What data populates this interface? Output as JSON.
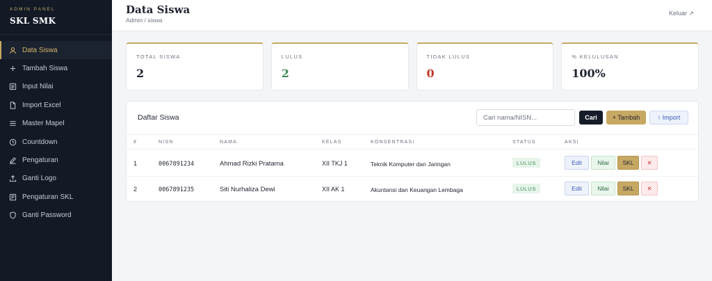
{
  "sidebar": {
    "panel_label": "ADMIN PANEL",
    "app_name": "SKL SMK",
    "items": [
      {
        "label": "Data Siswa",
        "icon": "user-icon",
        "active": true
      },
      {
        "label": "Tambah Siswa",
        "icon": "plus-icon"
      },
      {
        "label": "Input Nilai",
        "icon": "list-icon"
      },
      {
        "label": "Import Excel",
        "icon": "file-icon"
      },
      {
        "label": "Master Mapel",
        "icon": "menu-icon"
      },
      {
        "label": "Countdown",
        "icon": "clock-icon"
      },
      {
        "label": "Pengaturan",
        "icon": "pencil-icon"
      },
      {
        "label": "Ganti Logo",
        "icon": "upload-icon"
      },
      {
        "label": "Pengaturan SKL",
        "icon": "document-icon"
      },
      {
        "label": "Ganti Password",
        "icon": "shield-icon"
      }
    ]
  },
  "header": {
    "title": "Data Siswa",
    "breadcrumb": "Admin / siswa",
    "logout_label": "Keluar ↗"
  },
  "stats": [
    {
      "label": "TOTAL SISWA",
      "value": "2",
      "color": "#1f2430"
    },
    {
      "label": "LULUS",
      "value": "2",
      "color": "#3d8b55"
    },
    {
      "label": "TIDAK LULUS",
      "value": "0",
      "color": "#c0392b"
    },
    {
      "label": "% KELULUSAN",
      "value": "100%",
      "color": "#1f2430"
    }
  ],
  "table": {
    "title": "Daftar Siswa",
    "search_placeholder": "Cari nama/NISN...",
    "search_button": "Cari",
    "add_button": "+ Tambah",
    "import_button": "↑ Import",
    "columns": [
      "#",
      "NISN",
      "NAMA",
      "KELAS",
      "KONSENTRASI",
      "STATUS",
      "AKSI"
    ],
    "rows": [
      {
        "no": "1",
        "nisn": "0067891234",
        "nama": "Ahmad Rizki Pratama",
        "kelas": "XII TKJ 1",
        "konsentrasi": "Teknik Komputer dan Jaringan",
        "status": "LULUS"
      },
      {
        "no": "2",
        "nisn": "0067891235",
        "nama": "Siti Nurhaliza Dewi",
        "kelas": "XII AK 1",
        "konsentrasi": "Akuntansi dan Keuangan Lembaga",
        "status": "LULUS"
      }
    ],
    "actions": {
      "edit": "Edit",
      "nilai": "Nilai",
      "skl": "SKL",
      "delete": "✕"
    }
  },
  "colors": {
    "accent": "#c7a862",
    "sidebar_bg": "#131a26"
  }
}
